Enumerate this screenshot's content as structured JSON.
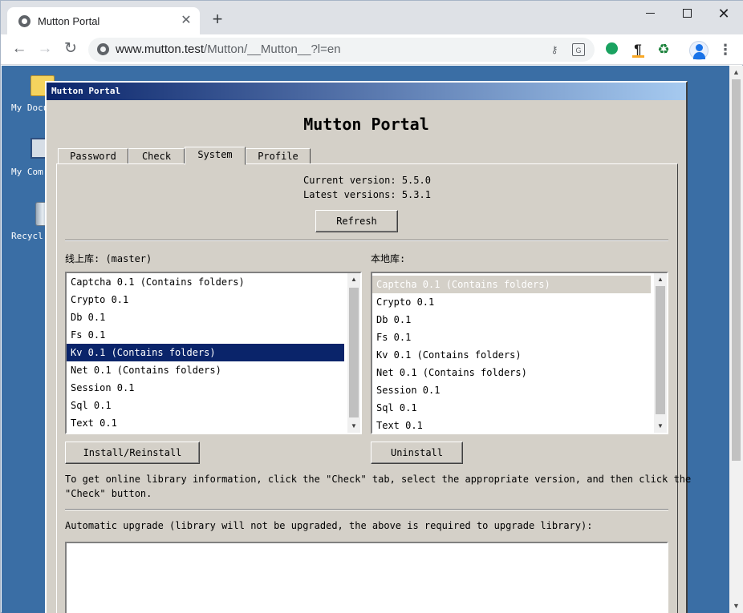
{
  "browser": {
    "tab_title": "Mutton Portal",
    "url_host": "www.mutton.test",
    "url_path": "/Mutton/__Mutton__?l=en",
    "icons": [
      "page-info-icon",
      "key-icon",
      "translate-icon",
      "green-extension-icon",
      "pilcrow-extension-icon",
      "recycle-extension-icon",
      "profile-avatar-icon",
      "menu-icon"
    ]
  },
  "desktop": {
    "icons": [
      {
        "label": "My Docu"
      },
      {
        "label": "My Com"
      },
      {
        "label": "Recycl"
      }
    ]
  },
  "app": {
    "window_title": "Mutton Portal",
    "heading": "Mutton Portal",
    "tabs": [
      {
        "label": "Password",
        "active": false
      },
      {
        "label": "Check",
        "active": false
      },
      {
        "label": "System",
        "active": true
      },
      {
        "label": "Profile",
        "active": false
      }
    ],
    "system": {
      "current_version": "Current version: 5.5.0",
      "latest_versions": "Latest versions: 5.3.1",
      "refresh_label": "Refresh",
      "online_label": "线上库: (master)",
      "local_label": "本地库:",
      "online_items": [
        {
          "text": "Captcha 0.1 (Contains folders)",
          "selected": false
        },
        {
          "text": "Crypto 0.1",
          "selected": false
        },
        {
          "text": "Db 0.1",
          "selected": false
        },
        {
          "text": "Fs 0.1",
          "selected": false
        },
        {
          "text": "Kv 0.1 (Contains folders)",
          "selected": true
        },
        {
          "text": "Net 0.1 (Contains folders)",
          "selected": false
        },
        {
          "text": "Session 0.1",
          "selected": false
        },
        {
          "text": "Sql 0.1",
          "selected": false
        },
        {
          "text": "Text 0.1",
          "selected": false
        }
      ],
      "local_items": [
        {
          "text": "Captcha 0.1 (Contains folders)",
          "selected": true
        },
        {
          "text": "Crypto 0.1",
          "selected": false
        },
        {
          "text": "Db 0.1",
          "selected": false
        },
        {
          "text": "Fs 0.1",
          "selected": false
        },
        {
          "text": "Kv 0.1 (Contains folders)",
          "selected": false
        },
        {
          "text": "Net 0.1 (Contains folders)",
          "selected": false
        },
        {
          "text": "Session 0.1",
          "selected": false
        },
        {
          "text": "Sql 0.1",
          "selected": false
        },
        {
          "text": "Text 0.1",
          "selected": false
        }
      ],
      "install_label": "Install/Reinstall",
      "uninstall_label": "Uninstall",
      "info_line1": "To get online library information, click the \"Check\" tab, select the appropriate version, and then click the",
      "info_line2": "\"Check\" button.",
      "auto_upgrade_label": "Automatic upgrade (library will not be upgraded, the above is required to upgrade library):",
      "auto_upgrade_value": ""
    }
  }
}
